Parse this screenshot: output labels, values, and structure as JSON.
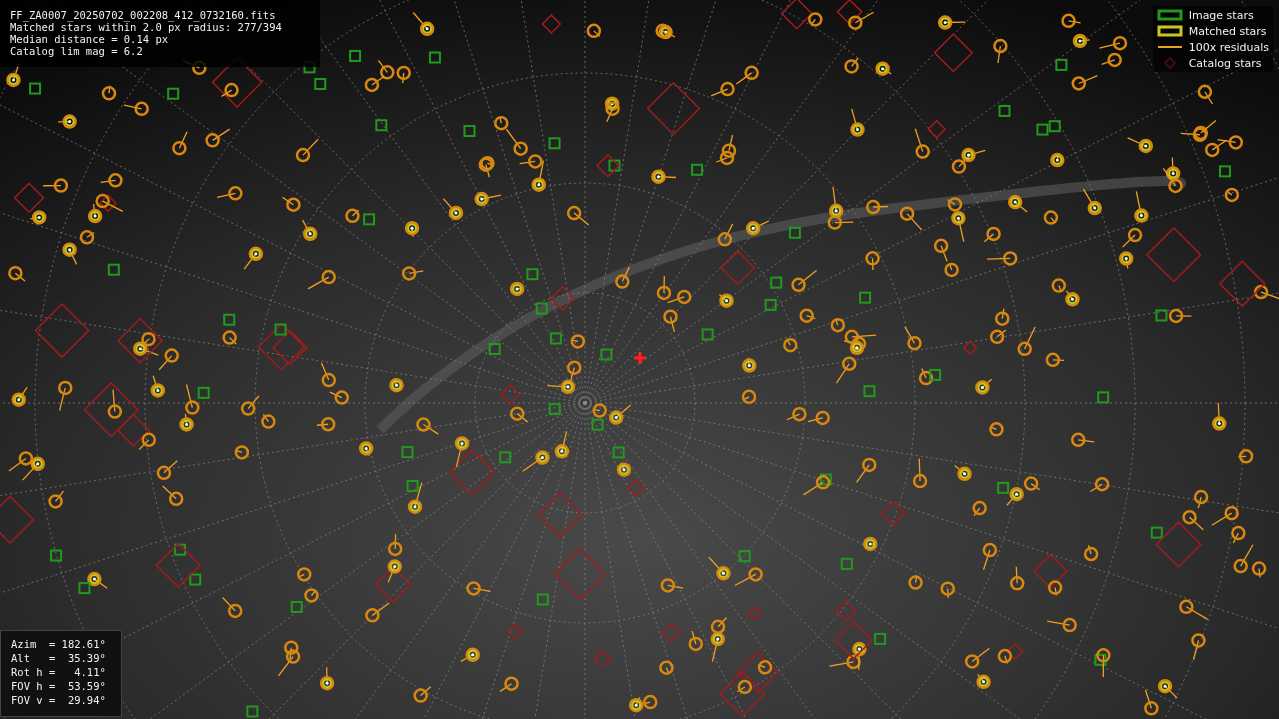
{
  "info": {
    "lines": [
      "FF_ZA0007_20250702_002208_412_0732160.fits",
      "Matched stars within 2.0 px radius: 277/394",
      "Median distance = 0.14 px",
      "Catalog lim mag = 6.2"
    ]
  },
  "legend": [
    {
      "kind": "square",
      "color": "#1f9a1f",
      "label": "Image stars"
    },
    {
      "kind": "square",
      "color": "#c8c81e",
      "label": "Matched stars"
    },
    {
      "kind": "line",
      "color": "#f0a020",
      "label": "100x residuals"
    },
    {
      "kind": "diamond",
      "color": "#5a0c0c",
      "label": "Catalog stars"
    }
  ],
  "pointing": {
    "lines": [
      "Azim  = 182.61°",
      "Alt   =  35.39°",
      "Rot h =   4.11°",
      "FOV h =  53.59°",
      "FOV v =  29.94°"
    ]
  }
}
